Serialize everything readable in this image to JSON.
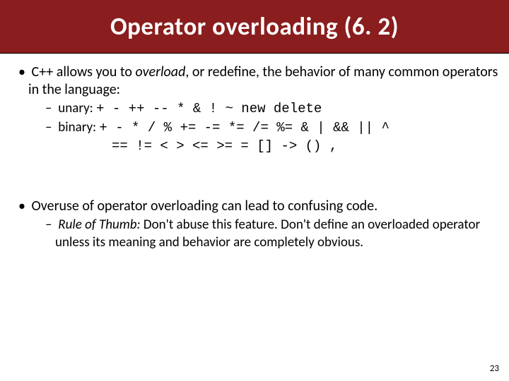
{
  "title": {
    "main": "Operator overloading",
    "section": "(6. 2)"
  },
  "bullets": {
    "b1": {
      "pre": "C++ allows you to ",
      "emph": "overload",
      "post": ", or redefine, the behavior of many common operators in the language:"
    },
    "b1_unary": {
      "label": "unary: ",
      "ops": "+ - ++ -- * & ! ~ new delete"
    },
    "b1_binary": {
      "label": "binary: ",
      "ops1": "+ - * / % += -= *= /= %= & | && || ^",
      "ops2": "== != < > <= >= = [] -> () ,"
    },
    "b2": "Overuse of operator overloading can lead to confusing code.",
    "b2_sub": {
      "lead": "Rule of Thumb:",
      "rest": " Don't abuse this feature.  Don't define an overloaded operator unless its meaning and behavior are completely obvious."
    }
  },
  "page_number": "23"
}
